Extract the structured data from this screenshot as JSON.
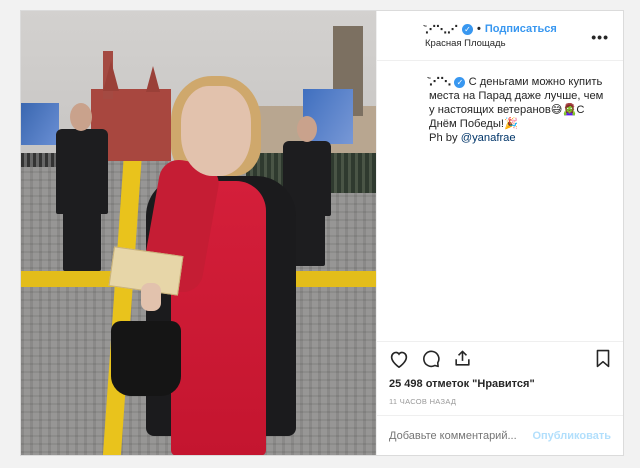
{
  "header": {
    "username_glyphs": "᷅⋰⋱⋰",
    "follow_label": "Подписаться",
    "location": "Красная Площадь",
    "more_label": "•••"
  },
  "caption": {
    "username_glyphs": "᷅⋰⋱",
    "text": "С деньгами можно купить места на Парад даже лучше, чем у настоящих ветеранов😅🧟‍♀️С Днём Победы!🎉",
    "credit_prefix": "Ph by ",
    "credit_link": "@yanafrae"
  },
  "stats": {
    "likes_text": "25 498 отметок \"Нравится\"",
    "time_text": "11 ЧАСОВ НАЗАД"
  },
  "comment": {
    "placeholder": "Добавьте комментарий...",
    "publish_label": "Опубликовать"
  },
  "icons": {
    "like": "heart-icon",
    "comment": "comment-icon",
    "share": "share-icon",
    "save": "bookmark-icon",
    "verified": "verified-badge-icon"
  },
  "colors": {
    "accent": "#3897f0",
    "publish_disabled": "#b2dffc",
    "muted": "#999999"
  }
}
